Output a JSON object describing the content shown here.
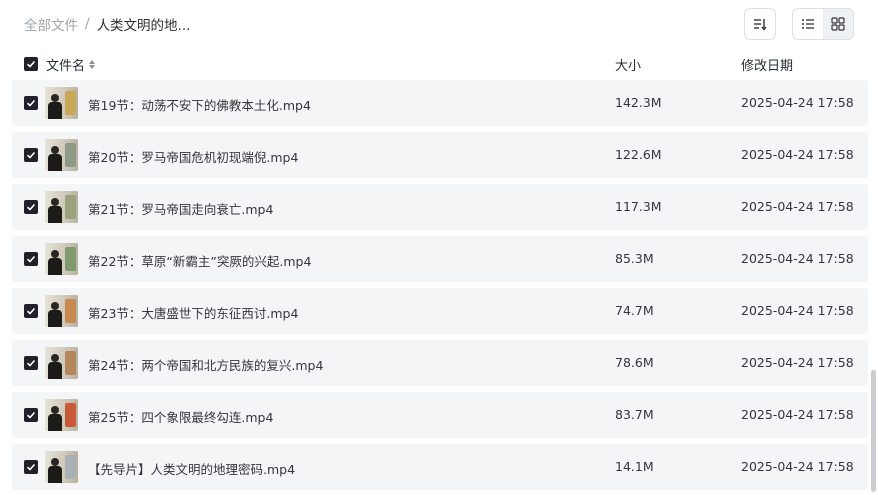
{
  "breadcrumb": {
    "root": "全部文件",
    "separator": "/",
    "current": "人类文明的地..."
  },
  "toolbar": {
    "sort_icon": "sort-icon",
    "list_view_icon": "list-view-icon",
    "grid_view_icon": "grid-view-icon",
    "active_view": "grid"
  },
  "table": {
    "headers": {
      "name": "文件名",
      "size": "大小",
      "modified": "修改日期"
    },
    "rows": [
      {
        "name": "第19节：动荡不安下的佛教本土化.mp4",
        "size": "142.3M",
        "modified": "2025-04-24 17:58",
        "checked": true,
        "accent": "#c9a85a"
      },
      {
        "name": "第20节：罗马帝国危机初现端倪.mp4",
        "size": "122.6M",
        "modified": "2025-04-24 17:58",
        "checked": true,
        "accent": "#8f9a86"
      },
      {
        "name": "第21节：罗马帝国走向衰亡.mp4",
        "size": "117.3M",
        "modified": "2025-04-24 17:58",
        "checked": true,
        "accent": "#9aa37c"
      },
      {
        "name": "第22节：草原“新霸主”突厥的兴起.mp4",
        "size": "85.3M",
        "modified": "2025-04-24 17:58",
        "checked": true,
        "accent": "#7f9a6e"
      },
      {
        "name": "第23节：大唐盛世下的东征西讨.mp4",
        "size": "74.7M",
        "modified": "2025-04-24 17:58",
        "checked": true,
        "accent": "#c78a54"
      },
      {
        "name": "第24节：两个帝国和北方民族的复兴.mp4",
        "size": "78.6M",
        "modified": "2025-04-24 17:58",
        "checked": true,
        "accent": "#b4865c"
      },
      {
        "name": "第25节：四个象限最终勾连.mp4",
        "size": "83.7M",
        "modified": "2025-04-24 17:58",
        "checked": true,
        "accent": "#c85a3a"
      },
      {
        "name": "【先导片】人类文明的地理密码.mp4",
        "size": "14.1M",
        "modified": "2025-04-24 17:58",
        "checked": true,
        "accent": "#a9b0b6"
      }
    ]
  },
  "colors": {
    "row_bg": "#f4f5f7",
    "checkbox": "#1f2329",
    "text": "#33363b",
    "muted": "#a0a4ab"
  }
}
